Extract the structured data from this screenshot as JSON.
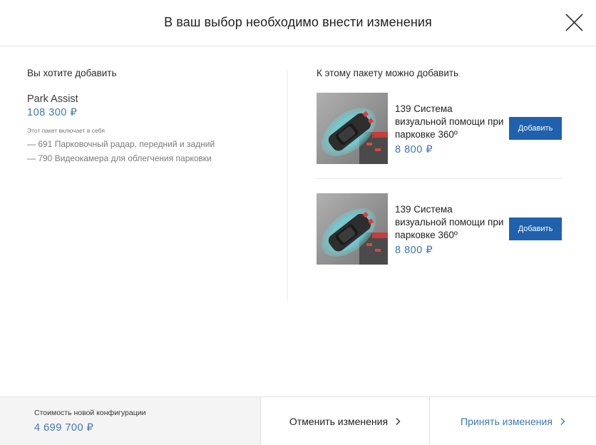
{
  "header": {
    "title": "В ваш выбор необходимо внести изменения"
  },
  "icons": {
    "close": "close-icon",
    "chevron": "chevron-right-icon"
  },
  "colors": {
    "accent": "#3d77b8",
    "button": "#1f61ad"
  },
  "left": {
    "heading": "Вы хотите добавить",
    "package_name": "Park Assist",
    "package_price": "108 300 ₽",
    "note": "Этот пакет включает в себя",
    "items": [
      "— 691 Парковочный радар, передний и задний",
      "— 790 Видеокамера для облегчения парковки"
    ]
  },
  "right": {
    "heading": "К этому пакету можно добавить",
    "offers": [
      {
        "name": "139 Система визуальной помощи при парковке 360º",
        "price": "8 800 ₽",
        "button": "Добавить"
      },
      {
        "name": "139 Система визуальной помощи при парковке 360º",
        "price": "8 800 ₽",
        "button": "Добавить"
      }
    ]
  },
  "footer": {
    "summary_label": "Стоимость новой конфигурации",
    "summary_total": "4 699 700 ₽",
    "cancel": "Отменить изменения",
    "accept": "Принять изменения"
  }
}
